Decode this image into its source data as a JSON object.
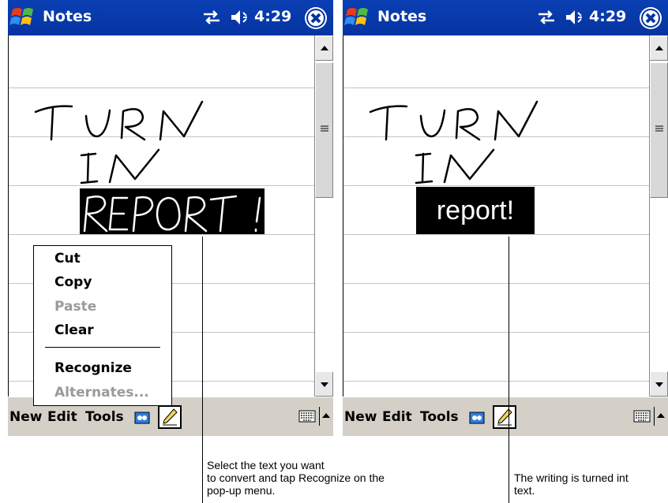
{
  "colors": {
    "titlebar": "#0634a1",
    "command_bar": "#d4d0c8",
    "selection": "#000000",
    "disabled_text": "#9a9a9a"
  },
  "left_screen": {
    "app_title": "Notes",
    "clock": "4:29",
    "icons": [
      "windows-start-icon",
      "connectivity-icon",
      "volume-icon",
      "close-icon",
      "scroll-up-icon",
      "scroll-down-icon",
      "keyboard-icon",
      "sip-up-arrow-icon",
      "recording-icon",
      "pen-icon"
    ],
    "handwriting": [
      "TURN",
      "IN",
      "REPORT!"
    ],
    "menu": {
      "new": "New",
      "edit": "Edit",
      "tools": "Tools"
    },
    "popup_menu": {
      "cut": "Cut",
      "copy": "Copy",
      "paste": "Paste",
      "clear": "Clear",
      "recognize": "Recognize",
      "alternates": "Alternates..."
    }
  },
  "right_screen": {
    "app_title": "Notes",
    "clock": "4:29",
    "handwriting": [
      "TURN",
      "IN"
    ],
    "recognized_text": "report!",
    "menu": {
      "new": "New",
      "edit": "Edit",
      "tools": "Tools"
    }
  },
  "captions": {
    "left": "Select the text you want\nto convert and tap Recognize on the\npop-up menu.",
    "right": "The writing is turned int\ntext."
  }
}
